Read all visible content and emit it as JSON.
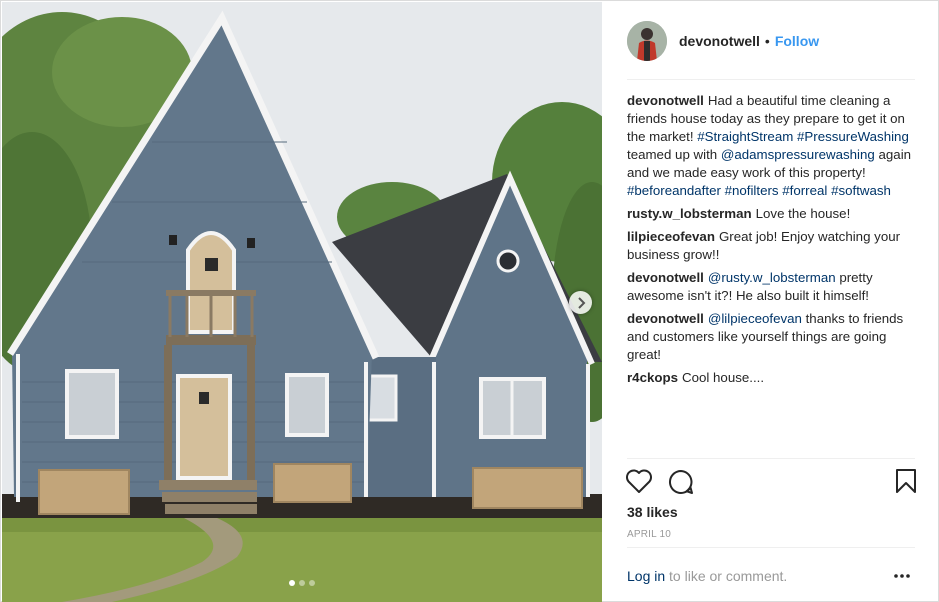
{
  "post": {
    "username": "devonotwell",
    "separator": "•",
    "follow_label": "Follow",
    "image_count_current": 1,
    "image_count_total": 3
  },
  "comments": [
    {
      "user": "devonotwell",
      "parts": [
        {
          "t": "Had a beautiful time cleaning a friends house today as they prepare to get it on the market! "
        },
        {
          "t": "#StraightStream",
          "link": true
        },
        {
          "t": " "
        },
        {
          "t": "#PressureWashing",
          "link": true
        },
        {
          "t": " teamed up with "
        },
        {
          "t": "@adamspressurewashing",
          "link": true
        },
        {
          "t": " again and we made easy work of this property! "
        },
        {
          "t": "#beforeandafter",
          "link": true
        },
        {
          "t": " "
        },
        {
          "t": "#nofilters",
          "link": true
        },
        {
          "t": " "
        },
        {
          "t": "#forreal",
          "link": true
        },
        {
          "t": " "
        },
        {
          "t": "#softwash",
          "link": true
        }
      ]
    },
    {
      "user": "rusty.w_lobsterman",
      "parts": [
        {
          "t": "Love the house!"
        }
      ]
    },
    {
      "user": "lilpieceofevan",
      "parts": [
        {
          "t": "Great job! Enjoy watching your business grow!!"
        }
      ]
    },
    {
      "user": "devonotwell",
      "parts": [
        {
          "t": "@rusty.w_lobsterman",
          "link": true
        },
        {
          "t": " pretty awesome isn't it?! He also built it himself!"
        }
      ]
    },
    {
      "user": "devonotwell",
      "parts": [
        {
          "t": "@lilpieceofevan",
          "link": true
        },
        {
          "t": " thanks to friends and customers like yourself things are going great!"
        }
      ]
    },
    {
      "user": "r4ckops",
      "parts": [
        {
          "t": "Cool house...."
        }
      ]
    }
  ],
  "stats": {
    "likes": "38 likes",
    "date": "APRIL 10"
  },
  "footer": {
    "login_label": "Log in",
    "suffix": " to like or comment.",
    "more_label": "•••"
  },
  "icons": {
    "like": "heart-icon",
    "comment": "comment-bubble-icon",
    "save": "bookmark-icon",
    "next": "chevron-right-icon",
    "more": "more-options-icon"
  },
  "colors": {
    "accent": "#3897f0",
    "link": "#003569",
    "muted": "#999999",
    "siding": "#5f7488"
  }
}
